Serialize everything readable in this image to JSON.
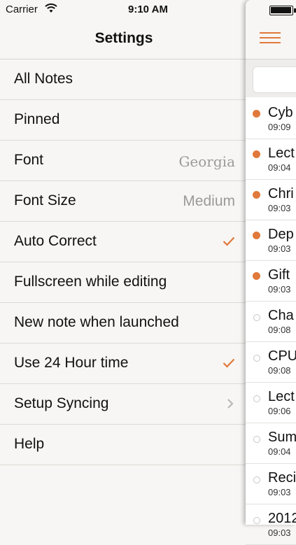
{
  "status": {
    "carrier": "Carrier",
    "time": "9:10 AM"
  },
  "nav": {
    "title": "Settings"
  },
  "settings": [
    {
      "label": "All Notes"
    },
    {
      "label": "Pinned"
    },
    {
      "label": "Font",
      "value": "Georgia"
    },
    {
      "label": "Font Size",
      "value": "Medium"
    },
    {
      "label": "Auto Correct",
      "checked": true
    },
    {
      "label": "Fullscreen while editing"
    },
    {
      "label": "New note when launched"
    },
    {
      "label": "Use 24 Hour time",
      "checked": true
    },
    {
      "label": "Setup Syncing",
      "disclosure": true
    },
    {
      "label": "Help"
    }
  ],
  "notes": [
    {
      "title": "Cyb",
      "time": "09:09",
      "pinned": true
    },
    {
      "title": "Lect",
      "time": "09:04",
      "pinned": true
    },
    {
      "title": "Chri",
      "time": "09:03",
      "pinned": true
    },
    {
      "title": "Dep",
      "time": "09:03",
      "pinned": true
    },
    {
      "title": "Gift",
      "time": "09:03",
      "pinned": true
    },
    {
      "title": "Cha",
      "time": "09:08",
      "pinned": false
    },
    {
      "title": "CPU",
      "time": "09:08",
      "pinned": false
    },
    {
      "title": "Lect",
      "time": "09:06",
      "pinned": false
    },
    {
      "title": "Sum",
      "time": "09:04",
      "pinned": false
    },
    {
      "title": "Reci",
      "time": "09:03",
      "pinned": false
    },
    {
      "title": "2012",
      "time": "09:03",
      "pinned": false
    }
  ],
  "colors": {
    "accent": "#e0793b",
    "background": "#f7f6f4"
  }
}
